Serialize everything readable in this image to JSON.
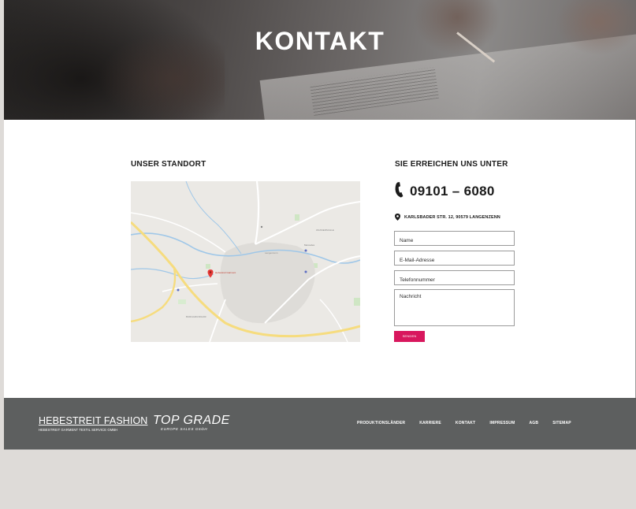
{
  "hero": {
    "title": "KONTAKT"
  },
  "location": {
    "heading": "UNSER STANDORT"
  },
  "contact": {
    "heading": "SIE ERREICHEN UNS UNTER",
    "phone": "09101 – 6080",
    "address": "KARLSBADER STR. 12, 90579 LANGENZENN"
  },
  "form": {
    "name_placeholder": "Name",
    "email_placeholder": "E-Mail-Adresse",
    "phone_placeholder": "Telefonnummer",
    "message_placeholder": "Nachricht",
    "submit_label": "SENDEN"
  },
  "footer": {
    "logo1_title": "HEBESTREIT FASHION",
    "logo1_subtitle": "HEBESTREIT GARMENT TEXTIL SERVICE GMBH",
    "logo2_title": "TOP GRADE",
    "logo2_subtitle": "EUROPE SALES GmbH",
    "nav": [
      "PRODUKTIONSLÄNDER",
      "KARRIERE",
      "KONTAKT",
      "IMPRESSUM",
      "AGB",
      "SITEMAP"
    ]
  },
  "colors": {
    "accent": "#d8175d",
    "footer_bg": "#5d5f5f",
    "page_bg": "#dedbd8"
  },
  "icons": {
    "phone": "phone-icon",
    "location": "map-pin-icon"
  }
}
